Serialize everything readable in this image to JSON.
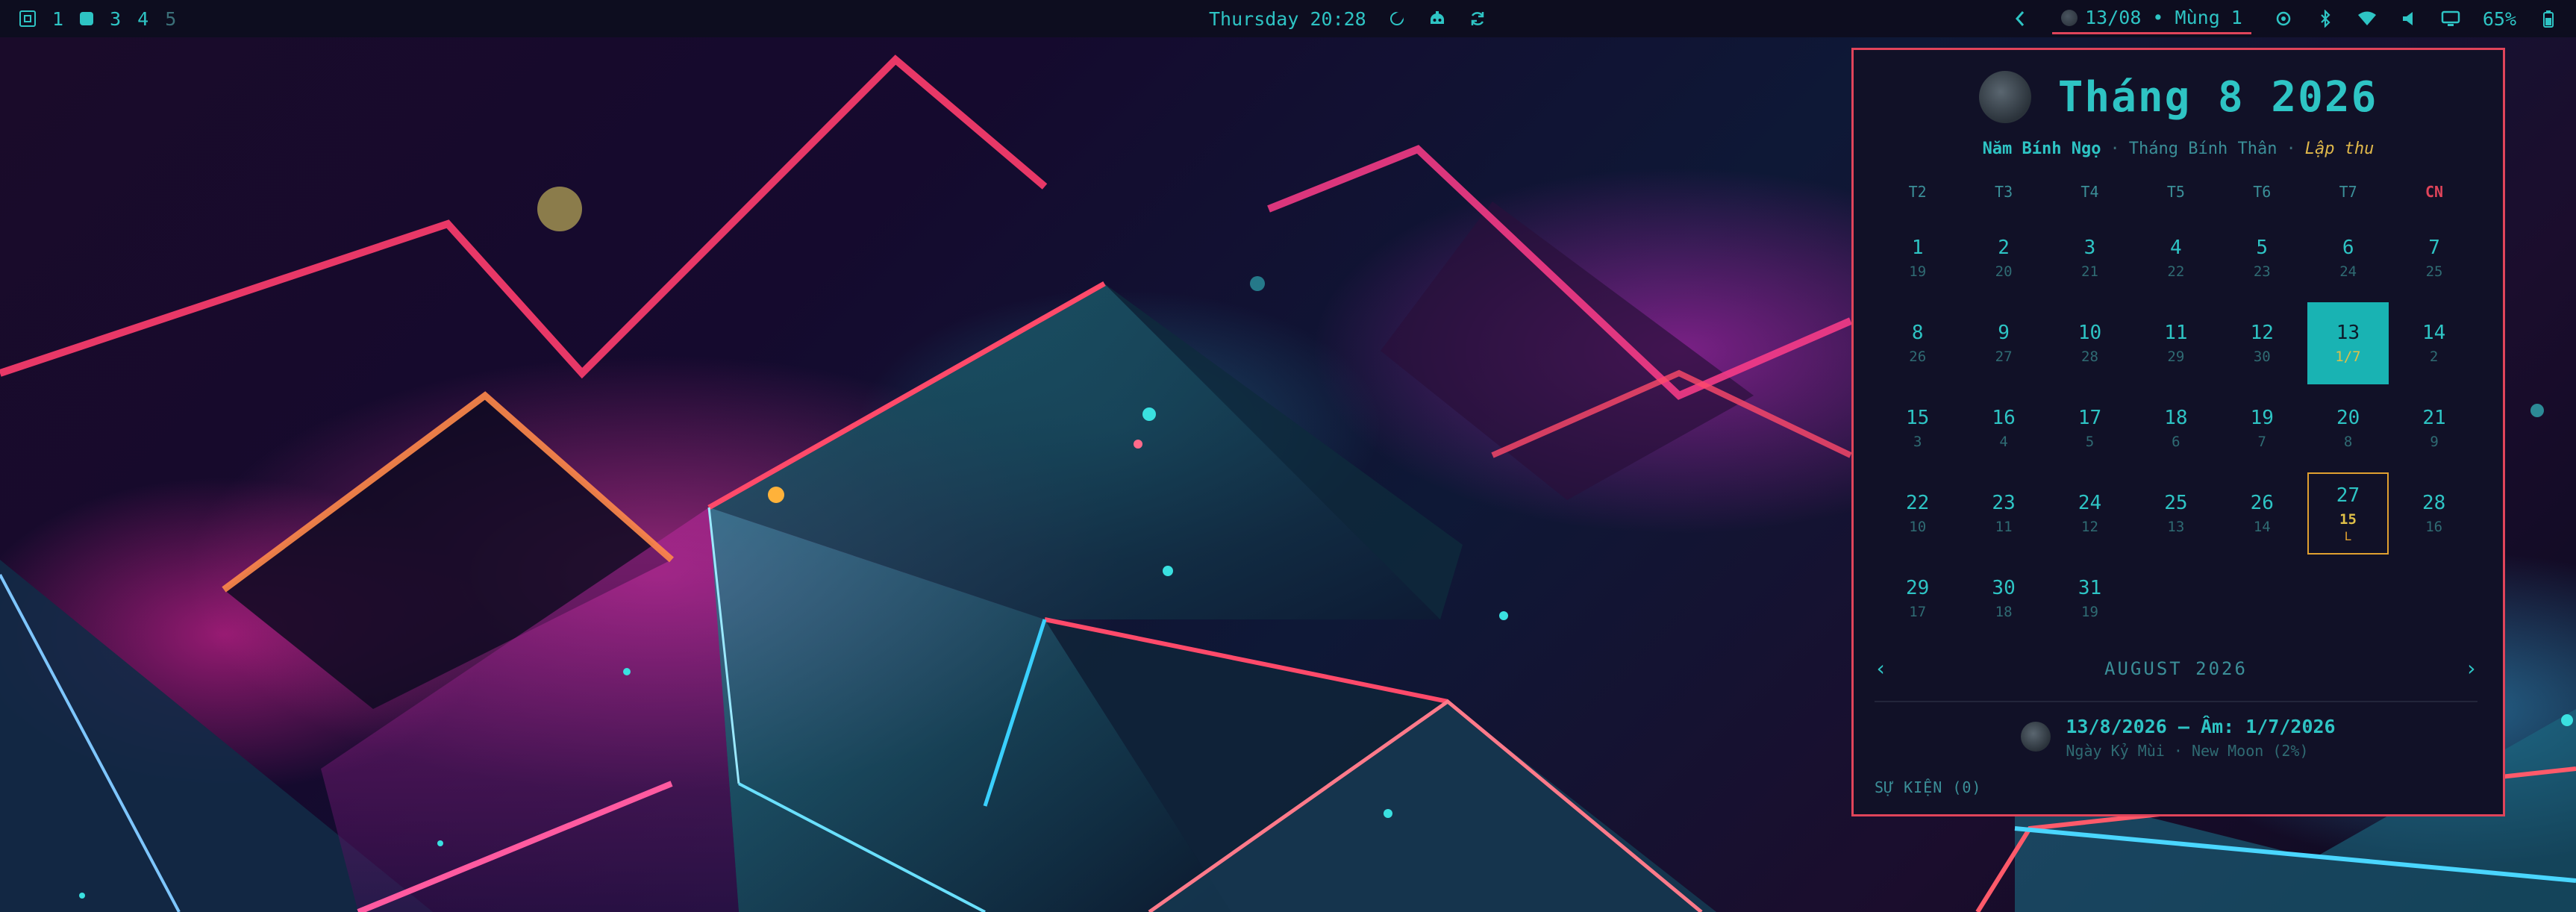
{
  "topbar": {
    "workspaces": [
      "1",
      "3",
      "4",
      "5"
    ],
    "clock": "Thursday 20:28",
    "lunar_pill": "13/08 • Mùng 1",
    "battery": "65%"
  },
  "calendar": {
    "title": "Tháng 8 2026",
    "year_can_chi": "Năm Bính Ngọ",
    "month_can_chi": "Tháng Bính Thân",
    "solar_term": "Lập thu",
    "weekdays": [
      "T2",
      "T3",
      "T4",
      "T5",
      "T6",
      "T7",
      "CN"
    ],
    "weeks": [
      [
        {
          "d": "1",
          "l": "19"
        },
        {
          "d": "2",
          "l": "20"
        },
        {
          "d": "3",
          "l": "21"
        },
        {
          "d": "4",
          "l": "22"
        },
        {
          "d": "5",
          "l": "23"
        },
        {
          "d": "6",
          "l": "24"
        },
        {
          "d": "7",
          "l": "25"
        }
      ],
      [
        {
          "d": "8",
          "l": "26"
        },
        {
          "d": "9",
          "l": "27"
        },
        {
          "d": "10",
          "l": "28"
        },
        {
          "d": "11",
          "l": "29"
        },
        {
          "d": "12",
          "l": "30"
        },
        {
          "d": "13",
          "l": "1/7",
          "today": true
        },
        {
          "d": "14",
          "l": "2"
        }
      ],
      [
        {
          "d": "15",
          "l": "3"
        },
        {
          "d": "16",
          "l": "4"
        },
        {
          "d": "17",
          "l": "5"
        },
        {
          "d": "18",
          "l": "6"
        },
        {
          "d": "19",
          "l": "7"
        },
        {
          "d": "20",
          "l": "8"
        },
        {
          "d": "21",
          "l": "9"
        }
      ],
      [
        {
          "d": "22",
          "l": "10"
        },
        {
          "d": "23",
          "l": "11"
        },
        {
          "d": "24",
          "l": "12"
        },
        {
          "d": "25",
          "l": "13"
        },
        {
          "d": "26",
          "l": "14"
        },
        {
          "d": "27",
          "l": "15",
          "full": true,
          "mark": "L"
        },
        {
          "d": "28",
          "l": "16"
        }
      ],
      [
        {
          "d": "29",
          "l": "17"
        },
        {
          "d": "30",
          "l": "18"
        },
        {
          "d": "31",
          "l": "19"
        }
      ]
    ],
    "nav_month": "AUGUST 2026",
    "selected_date": "13/8/2026 — Âm: 1/7/2026",
    "selected_detail": "Ngày Kỷ Mùi · New Moon (2%)",
    "events_label": "SỰ KIỆN (0)"
  },
  "colors": {
    "accent": "#2ec4c4",
    "border": "#e0445a",
    "today_bg": "#19b3b3",
    "full_moon": "#e0a030"
  }
}
